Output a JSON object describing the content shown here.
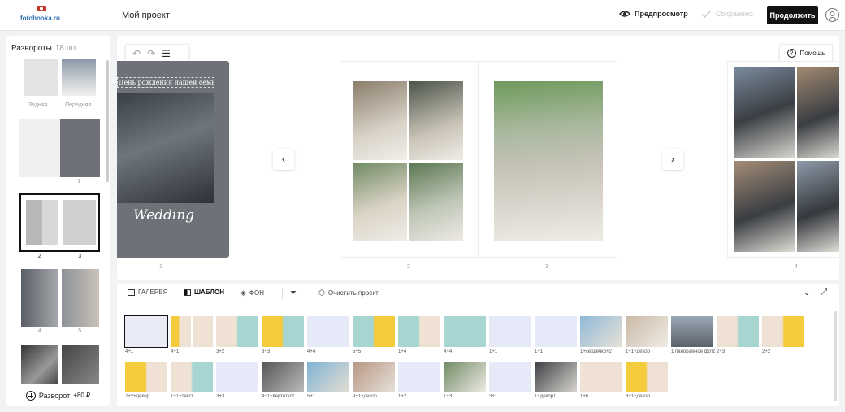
{
  "header": {
    "logo_text": "fotobooka.ru",
    "project_title": "Мой проект",
    "preview_label": "Предпросмотр",
    "saved_label": "Сохранено",
    "continue_label": "Продолжить"
  },
  "sidebar": {
    "title": "Развороты",
    "count": "18 шт",
    "spreads": [
      {
        "labels": [
          "Задняя",
          "Передняя"
        ]
      },
      {
        "labels": [
          "",
          "1"
        ]
      },
      {
        "labels": [
          "2",
          "3"
        ]
      },
      {
        "labels": [
          "4",
          "5"
        ]
      },
      {
        "labels": [
          "",
          ""
        ]
      }
    ],
    "add_label": "Разворот",
    "add_price": "+80 ₽"
  },
  "canvas": {
    "help_label": "Помощь",
    "cover_title": "День рождения нашей семьи",
    "cover_script": "Wedding",
    "page_numbers": [
      "1",
      "2",
      "3",
      "4"
    ],
    "prev_arrow": "‹",
    "next_arrow": "›"
  },
  "bottom": {
    "tabs": [
      "ГАЛЕРЕЯ",
      "ШАБЛОН",
      "ФОН"
    ],
    "clear_label": "Очистить проект",
    "templates_row1": [
      "4+1",
      "4+1",
      "3+2",
      "3+3",
      "4+4",
      "5+5",
      "1+4",
      "4+4",
      "1+1",
      "1+1",
      "1+сердечко+2",
      "1+1+декор",
      "1 панорамное фото",
      "2+3",
      "2+2"
    ],
    "templates_row2": [
      "2+2+декор",
      "1+1+текст",
      "3+3",
      "4+1+вертеткст",
      "5+1",
      "9+1+декор",
      "1+2",
      "1+3",
      "3+1",
      "1+декор1",
      "1+6",
      "8+1+декор"
    ]
  },
  "colors": {
    "accent_yellow": "#f4cb3c",
    "accent_teal": "#a6d5d2",
    "beige": "#efe1d3",
    "cover_bg": "#6e7278"
  }
}
